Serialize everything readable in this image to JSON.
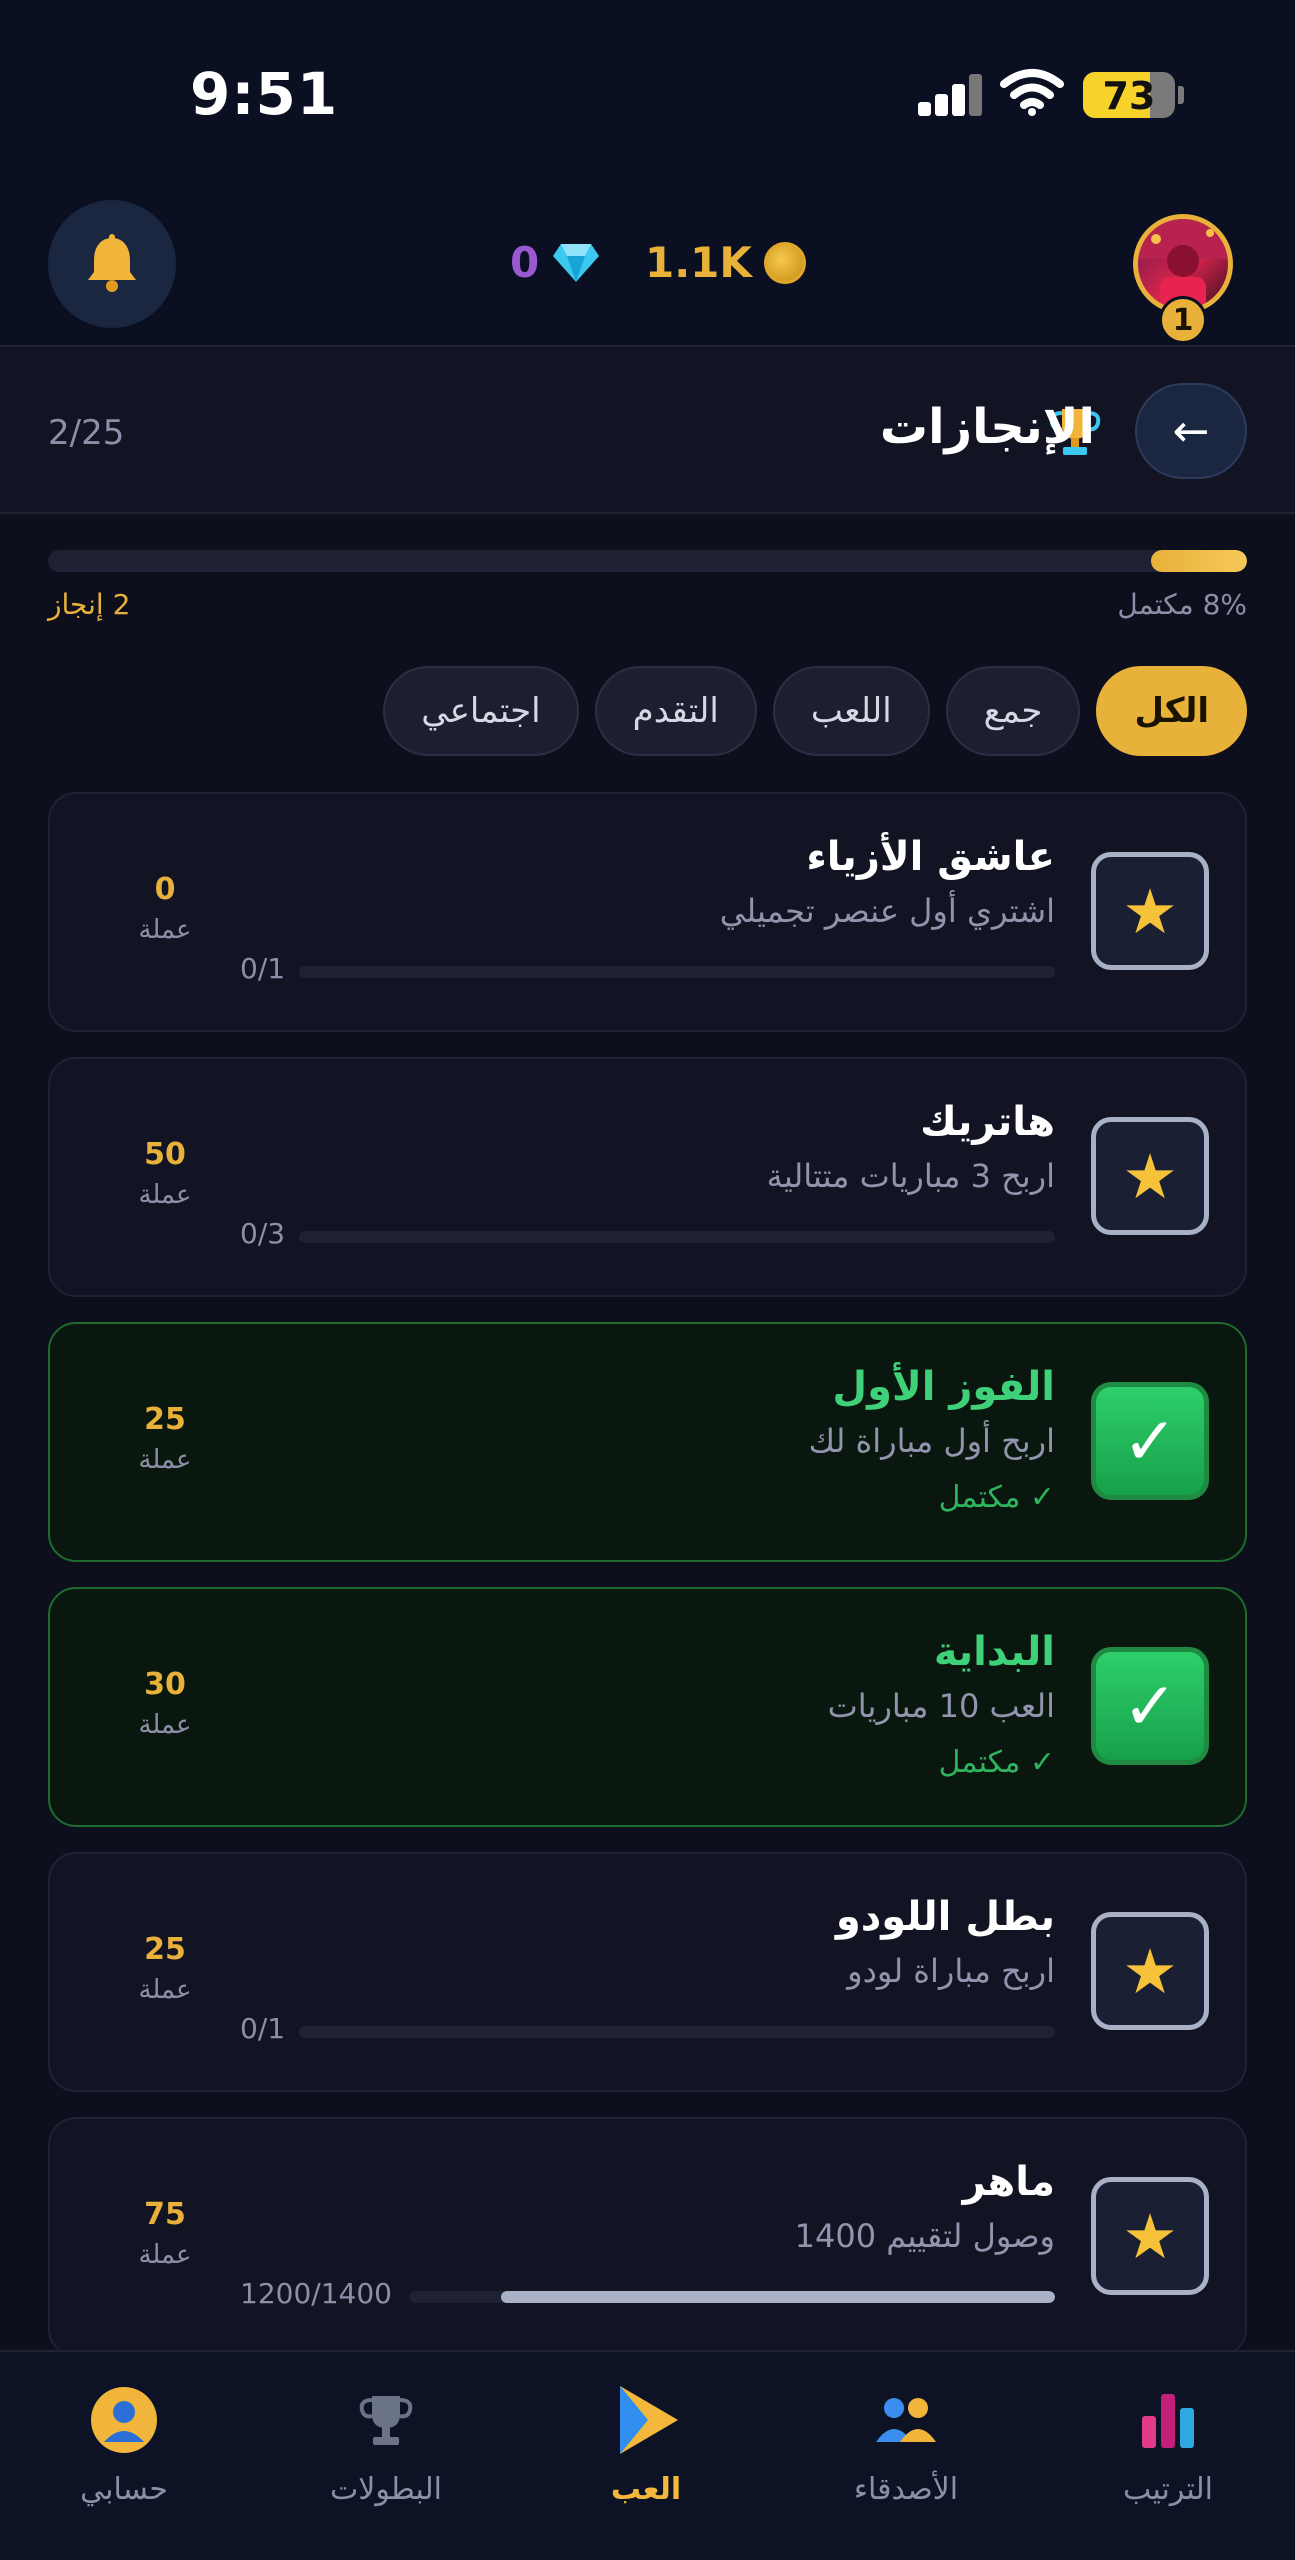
{
  "status_bar": {
    "time": "9:51",
    "battery": "73",
    "battery_level": 0.73
  },
  "header": {
    "gems": "0",
    "coins": "1.1K",
    "level": "1",
    "icons": [
      "bell-icon",
      "gem-icon",
      "coin-icon",
      "avatar"
    ]
  },
  "page": {
    "title": "الإنجازات",
    "counter": "2/25",
    "back_label": "←",
    "progress": 0.08,
    "progress_text": "8% مكتمل",
    "count_text": "2 إنجاز"
  },
  "filters": [
    {
      "label": "الكل",
      "active": true
    },
    {
      "label": "جمع",
      "active": false
    },
    {
      "label": "اللعب",
      "active": false
    },
    {
      "label": "التقدم",
      "active": false
    },
    {
      "label": "اجتماعي",
      "active": false
    }
  ],
  "achievements": [
    {
      "title": "عاشق الأزياء",
      "desc": "اشتري أول عنصر تجميلي",
      "progress": "0/1",
      "fraction": 0,
      "reward": "0",
      "unit": "عملة",
      "done": false
    },
    {
      "title": "هاتريك",
      "desc": "اربح 3 مباريات متتالية",
      "progress": "0/3",
      "fraction": 0,
      "reward": "50",
      "unit": "عملة",
      "done": false
    },
    {
      "title": "الفوز الأول",
      "desc": "اربح أول مباراة لك",
      "status": "✓ مكتمل",
      "reward": "25",
      "unit": "عملة",
      "done": true
    },
    {
      "title": "البداية",
      "desc": "العب 10 مباريات",
      "status": "✓ مكتمل",
      "reward": "30",
      "unit": "عملة",
      "done": true
    },
    {
      "title": "بطل اللودو",
      "desc": "اربح مباراة لودو",
      "progress": "0/1",
      "fraction": 0,
      "reward": "25",
      "unit": "عملة",
      "done": false
    },
    {
      "title": "ماهر",
      "desc": "وصول لتقييم 1400",
      "progress": "1200/1400",
      "fraction": 0.857,
      "reward": "75",
      "unit": "عملة",
      "done": false
    }
  ],
  "nav": [
    {
      "label": "حسابي",
      "icon": "profile-icon",
      "active": false
    },
    {
      "label": "البطولات",
      "icon": "trophy-icon",
      "active": false
    },
    {
      "label": "العب",
      "icon": "play-icon",
      "active": true
    },
    {
      "label": "الأصدقاء",
      "icon": "friends-icon",
      "active": false
    },
    {
      "label": "الترتيب",
      "icon": "leaderboard-icon",
      "active": false
    }
  ],
  "colors": {
    "accent": "#e8b13a",
    "success": "#2fb35e",
    "background": "#0d0f1c"
  }
}
